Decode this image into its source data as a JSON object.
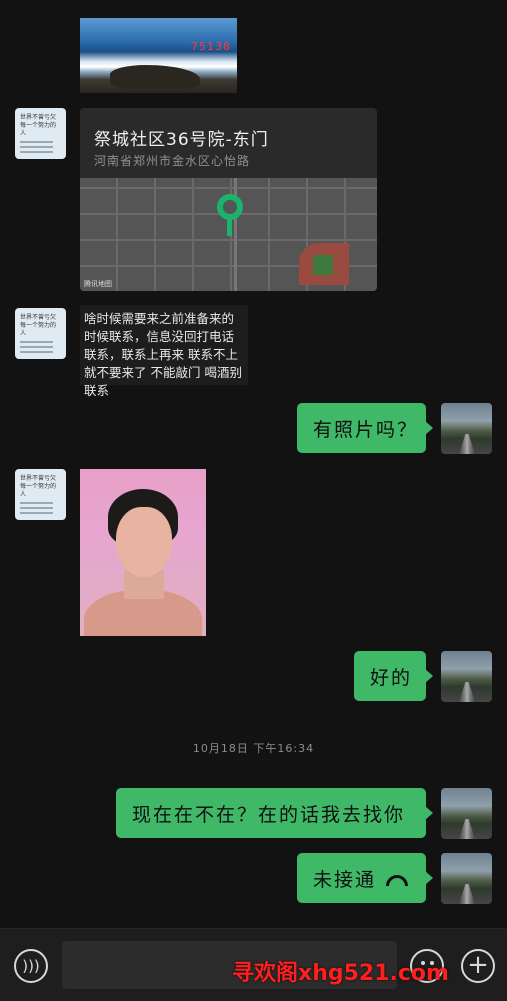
{
  "messages": {
    "photo_top": {
      "watermark": "75138"
    },
    "location": {
      "title": "祭城社区36号院-东门",
      "address": "河南省郑州市金水区心怡路",
      "map_credit": "腾讯地图"
    },
    "incoming_text": "啥时候需要来之前准备来的时候联系，信息没回打电话联系，联系上再来   联系不上就不要来了  不能敲门  喝酒别联系",
    "outgoing_1": "有照片吗？",
    "outgoing_2": "好的",
    "timestamp": "10月18日  下午16:34",
    "outgoing_3": "现在在不在？在的话我去找你",
    "outgoing_call": "未接通"
  },
  "contact_avatar": {
    "line1": "世界不曾亏欠",
    "line2": "每一个努力的人"
  },
  "watermark_text": "寻欢阁xhg521.com",
  "colors": {
    "background": "#121212",
    "bubble_green": "#3fb868",
    "bubble_dark": "#1d1d1d",
    "watermark": "#ff1f1f"
  }
}
